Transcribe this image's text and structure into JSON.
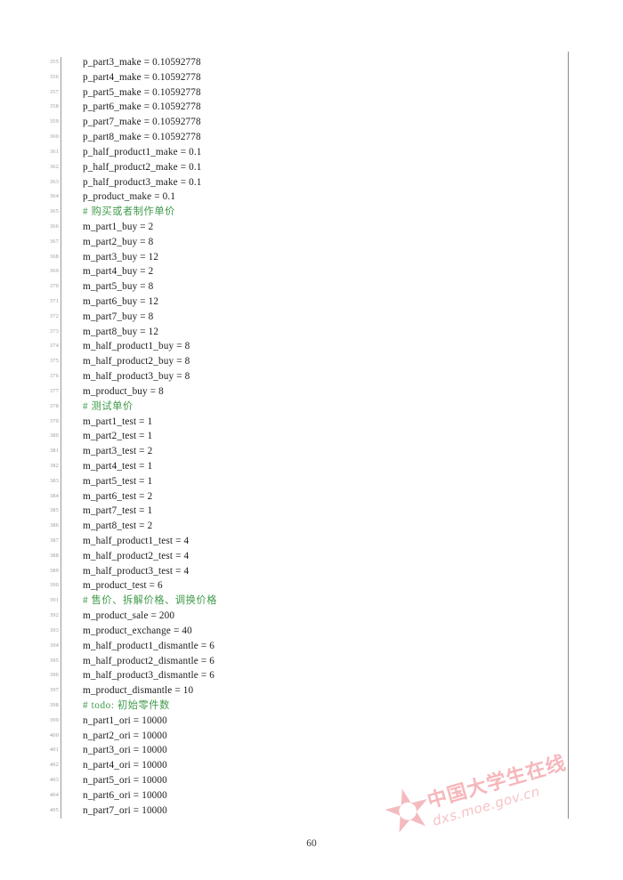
{
  "document": {
    "page_number": "60",
    "watermark": {
      "star_glyph": "✫",
      "organization": "中国大学生在线",
      "url": "dxs.moe.gov.cn"
    }
  },
  "listing": {
    "language_hint": "python",
    "comment_color": "#3f9b4a",
    "code_color": "#1a1a1a",
    "lineno_color": "#9b9b9b",
    "lines": [
      {
        "no": "355",
        "text": "p_part3_make = 0.10592778",
        "kind": "code"
      },
      {
        "no": "356",
        "text": "p_part4_make = 0.10592778",
        "kind": "code"
      },
      {
        "no": "357",
        "text": "p_part5_make = 0.10592778",
        "kind": "code"
      },
      {
        "no": "358",
        "text": "p_part6_make = 0.10592778",
        "kind": "code"
      },
      {
        "no": "359",
        "text": "p_part7_make = 0.10592778",
        "kind": "code"
      },
      {
        "no": "360",
        "text": "p_part8_make = 0.10592778",
        "kind": "code"
      },
      {
        "no": "361",
        "text": "p_half_product1_make = 0.1",
        "kind": "code"
      },
      {
        "no": "362",
        "text": "p_half_product2_make = 0.1",
        "kind": "code"
      },
      {
        "no": "363",
        "text": "p_half_product3_make = 0.1",
        "kind": "code"
      },
      {
        "no": "364",
        "text": "p_product_make = 0.1",
        "kind": "code"
      },
      {
        "no": "365",
        "text": "# 购买或者制作单价",
        "kind": "comment"
      },
      {
        "no": "366",
        "text": "m_part1_buy = 2",
        "kind": "code"
      },
      {
        "no": "367",
        "text": "m_part2_buy = 8",
        "kind": "code"
      },
      {
        "no": "368",
        "text": "m_part3_buy = 12",
        "kind": "code"
      },
      {
        "no": "369",
        "text": "m_part4_buy = 2",
        "kind": "code"
      },
      {
        "no": "370",
        "text": "m_part5_buy = 8",
        "kind": "code"
      },
      {
        "no": "371",
        "text": "m_part6_buy = 12",
        "kind": "code"
      },
      {
        "no": "372",
        "text": "m_part7_buy = 8",
        "kind": "code"
      },
      {
        "no": "373",
        "text": "m_part8_buy = 12",
        "kind": "code"
      },
      {
        "no": "374",
        "text": "m_half_product1_buy = 8",
        "kind": "code"
      },
      {
        "no": "375",
        "text": "m_half_product2_buy = 8",
        "kind": "code"
      },
      {
        "no": "376",
        "text": "m_half_product3_buy = 8",
        "kind": "code"
      },
      {
        "no": "377",
        "text": "m_product_buy = 8",
        "kind": "code"
      },
      {
        "no": "378",
        "text": "# 测试单价",
        "kind": "comment"
      },
      {
        "no": "379",
        "text": "m_part1_test = 1",
        "kind": "code"
      },
      {
        "no": "380",
        "text": "m_part2_test = 1",
        "kind": "code"
      },
      {
        "no": "381",
        "text": "m_part3_test = 2",
        "kind": "code"
      },
      {
        "no": "382",
        "text": "m_part4_test = 1",
        "kind": "code"
      },
      {
        "no": "383",
        "text": "m_part5_test = 1",
        "kind": "code"
      },
      {
        "no": "384",
        "text": "m_part6_test = 2",
        "kind": "code"
      },
      {
        "no": "385",
        "text": "m_part7_test = 1",
        "kind": "code"
      },
      {
        "no": "386",
        "text": "m_part8_test = 2",
        "kind": "code"
      },
      {
        "no": "387",
        "text": "m_half_product1_test = 4",
        "kind": "code"
      },
      {
        "no": "388",
        "text": "m_half_product2_test = 4",
        "kind": "code"
      },
      {
        "no": "389",
        "text": "m_half_product3_test = 4",
        "kind": "code"
      },
      {
        "no": "390",
        "text": "m_product_test = 6",
        "kind": "code"
      },
      {
        "no": "391",
        "text": "# 售价、拆解价格、调换价格",
        "kind": "comment"
      },
      {
        "no": "392",
        "text": "m_product_sale = 200",
        "kind": "code"
      },
      {
        "no": "393",
        "text": "m_product_exchange = 40",
        "kind": "code"
      },
      {
        "no": "394",
        "text": "m_half_product1_dismantle = 6",
        "kind": "code"
      },
      {
        "no": "395",
        "text": "m_half_product2_dismantle = 6",
        "kind": "code"
      },
      {
        "no": "396",
        "text": "m_half_product3_dismantle = 6",
        "kind": "code"
      },
      {
        "no": "397",
        "text": "m_product_dismantle = 10",
        "kind": "code"
      },
      {
        "no": "398",
        "text": "# todo: 初始零件数",
        "kind": "comment"
      },
      {
        "no": "399",
        "text": "n_part1_ori = 10000",
        "kind": "code"
      },
      {
        "no": "400",
        "text": "n_part2_ori = 10000",
        "kind": "code"
      },
      {
        "no": "401",
        "text": "n_part3_ori = 10000",
        "kind": "code"
      },
      {
        "no": "402",
        "text": "n_part4_ori = 10000",
        "kind": "code"
      },
      {
        "no": "403",
        "text": "n_part5_ori = 10000",
        "kind": "code"
      },
      {
        "no": "404",
        "text": "n_part6_ori = 10000",
        "kind": "code"
      },
      {
        "no": "405",
        "text": "n_part7_ori = 10000",
        "kind": "code"
      }
    ]
  }
}
